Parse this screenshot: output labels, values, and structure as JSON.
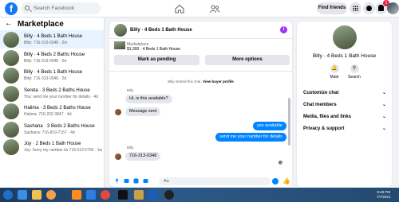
{
  "topbar": {
    "logo": "f",
    "search_placeholder": "Search Facebook",
    "find_friends": "Find friends",
    "notification_count": "1"
  },
  "sidebar": {
    "title": "Marketplace",
    "items": [
      {
        "name": "Billy · 4 Beds 1 Bath House",
        "sub": "Billy: 716-313-0348 · 2m"
      },
      {
        "name": "Billy · 4 Beds 2 Baths House",
        "sub": "Billy: 716-313-0348 · 2d"
      },
      {
        "name": "Billy · 4 Beds 1 Bath House",
        "sub": "Billy: 716-313-0348 · 2d"
      },
      {
        "name": "Sereta · 3 Beds 2 Baths House",
        "sub": "You: send me your number for details · 4d"
      },
      {
        "name": "Halima · 3 Beds 2 Baths House",
        "sub": "Halima: 716-292-3847 · 4d"
      },
      {
        "name": "Sashana · 3 Beds 2 Baths House",
        "sub": "Sashana: 716-819-7157 · 4d"
      },
      {
        "name": "Joy · 2 Beds 1 Bath House",
        "sub": "Joy: Sorry my number its 716 513 6700 · 1w"
      }
    ]
  },
  "chat": {
    "title": "Billy · 4 Beds 1 Bath House",
    "info_icon": "i",
    "listing_label": "Marketplace",
    "listing_price": "$1,300 · 4 Beds 1 Bath House",
    "mark_pending": "Mark as pending",
    "more_options": "More options",
    "started_text": "Billy started this chat.",
    "view_profile": "View buyer profile",
    "sender1": "Billy",
    "msg1": "Hi, is this available?",
    "msg2": "Message sent",
    "msg3": "yes available",
    "msg4": "send me your number for details",
    "sender2": "Billy",
    "msg5": "716-313-0348",
    "composer_placeholder": "Aa"
  },
  "right_panel": {
    "name": "Billy · 4 Beds 1 Bath House",
    "mute": "Mute",
    "search": "Search",
    "rows": [
      "Customize chat",
      "Chat members",
      "Media, files and links",
      "Privacy & support"
    ]
  },
  "taskbar": {
    "time": "9:48 PM",
    "date": "7/7/2021"
  },
  "colors": {
    "brand_blue": "#1877f2",
    "messenger_blue": "#0084ff",
    "active_row": "#e7f3ff"
  }
}
